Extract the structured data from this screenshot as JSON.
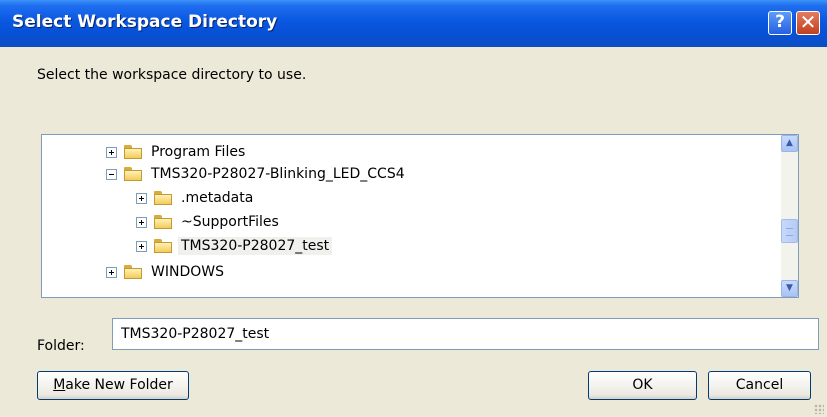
{
  "window": {
    "title": "Select Workspace Directory",
    "help_glyph": "?",
    "close_glyph": "✕"
  },
  "prompt": "Select the workspace directory to use.",
  "tree": {
    "items": [
      {
        "label": "Program Files",
        "expander": "plus"
      },
      {
        "label": "TMS320-P28027-Blinking_LED_CCS4",
        "expander": "minus"
      },
      {
        "label": ".metadata",
        "expander": "plus"
      },
      {
        "label": "~SupportFiles",
        "expander": "plus"
      },
      {
        "label": "TMS320-P28027_test",
        "expander": "plus",
        "selected": true
      },
      {
        "label": "WINDOWS",
        "expander": "plus"
      }
    ],
    "scroll_up_glyph": "▲",
    "scroll_down_glyph": "▼"
  },
  "folder": {
    "label": "Folder:",
    "value": "TMS320-P28027_test"
  },
  "buttons": {
    "make_new_folder_mnemonic": "M",
    "make_new_folder_rest": "ake New Folder",
    "ok": "OK",
    "cancel": "Cancel"
  }
}
